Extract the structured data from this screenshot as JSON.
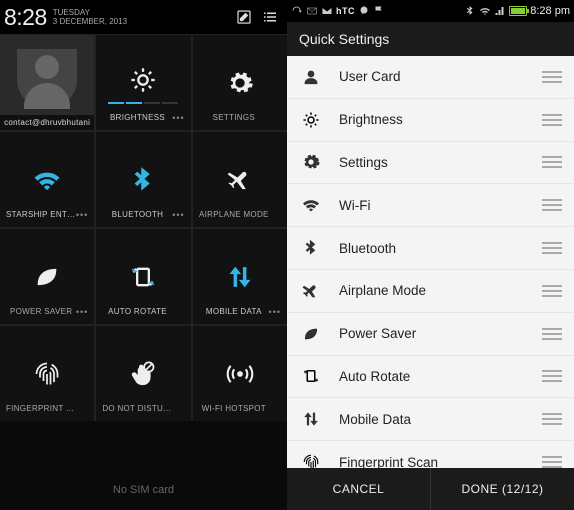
{
  "left": {
    "clock": "8:28",
    "weekday": "TUESDAY",
    "date": "3 DECEMBER, 2013",
    "footer": "No SIM card",
    "tiles": {
      "profile_label": "contact@dhruvbhutani",
      "brightness": "BRIGHTNESS",
      "settings": "SETTINGS",
      "wifi": "Starship Enterprise",
      "bluetooth": "BLUETOOTH",
      "airplane": "AIRPLANE MODE",
      "powersaver": "POWER SAVER",
      "autorotate": "AUTO ROTATE",
      "mobiledata": "MOBILE DATA",
      "fingerprint": "FINGERPRINT SCAN",
      "dnd": "DO NOT DISTURB",
      "hotspot": "WI-FI HOTSPOT"
    }
  },
  "right": {
    "status_time": "8:28 pm",
    "title": "Quick Settings",
    "items": [
      {
        "label": "User Card",
        "icon": "user"
      },
      {
        "label": "Brightness",
        "icon": "brightness"
      },
      {
        "label": "Settings",
        "icon": "settings"
      },
      {
        "label": "Wi-Fi",
        "icon": "wifi"
      },
      {
        "label": "Bluetooth",
        "icon": "bluetooth"
      },
      {
        "label": "Airplane Mode",
        "icon": "airplane"
      },
      {
        "label": "Power Saver",
        "icon": "powersaver"
      },
      {
        "label": "Auto Rotate",
        "icon": "autorotate"
      },
      {
        "label": "Mobile Data",
        "icon": "mobiledata"
      },
      {
        "label": "Fingerprint Scan",
        "icon": "fingerprint"
      }
    ],
    "cancel": "CANCEL",
    "done": "DONE  (12/12)"
  }
}
